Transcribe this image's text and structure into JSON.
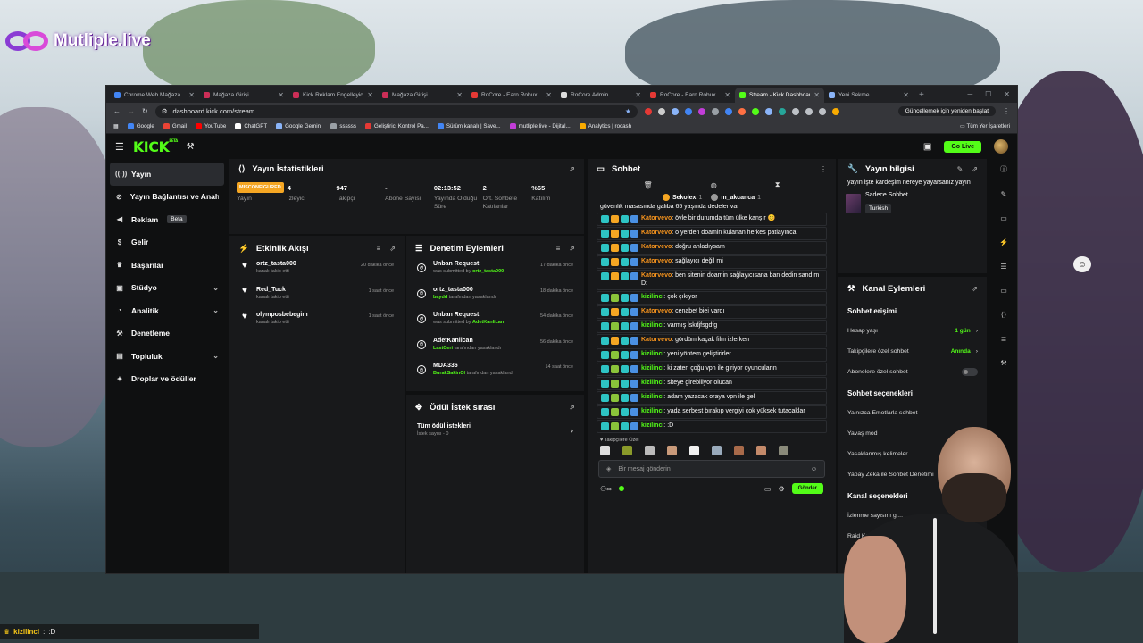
{
  "overlay": {
    "logo_text": "Mutliple.live"
  },
  "bottom_chat": {
    "user": "kizilinci",
    "text": ":D"
  },
  "browser": {
    "tabs": [
      {
        "label": "Chrome Web Mağaza",
        "color": "#4285f4"
      },
      {
        "label": "Mağaza Girişi",
        "color": "#cc2e57"
      },
      {
        "label": "Kick Reklam Engelleyici",
        "color": "#cc2e57"
      },
      {
        "label": "Mağaza Girişi",
        "color": "#cc2e57"
      },
      {
        "label": "RoCore - Earn Robux",
        "color": "#e53935"
      },
      {
        "label": "RoCore Admin",
        "color": "#dddddd"
      },
      {
        "label": "RoCore - Earn Robux",
        "color": "#e53935"
      },
      {
        "label": "Stream - Kick Dashboard",
        "color": "#53fc18"
      },
      {
        "label": "Yeni Sekme",
        "color": "#8ab4f8"
      }
    ],
    "url": "dashboard.kick.com/stream",
    "update_btn": "Güncellemek için yeniden başlat",
    "bookmarks": [
      {
        "label": "Google",
        "color": "#4285f4"
      },
      {
        "label": "Gmail",
        "color": "#ea4335"
      },
      {
        "label": "YouTube",
        "color": "#ff0000"
      },
      {
        "label": "ChatGPT",
        "color": "#ffffff"
      },
      {
        "label": "Google Gemini",
        "color": "#8ab4f8"
      },
      {
        "label": "ssssss",
        "color": "#9aa0a6"
      },
      {
        "label": "Geliştirici Kontrol Pa...",
        "color": "#e53935"
      },
      {
        "label": "Sürüm kanalı | Save...",
        "color": "#4285f4"
      },
      {
        "label": "mutliple.live - Dijital...",
        "color": "#c23dd8"
      },
      {
        "label": "Analytics | rocash",
        "color": "#f9ab00"
      }
    ],
    "all_bookmarks": "Tüm Yer İşaretleri"
  },
  "kick": {
    "logo": "KICK",
    "logo_sup": "BETA",
    "go_live": "Go Live"
  },
  "sidebar": {
    "items": [
      {
        "label": "Yayın",
        "icon": "broadcast-icon"
      },
      {
        "label": "Yayın Bağlantısı ve Anahtarı",
        "icon": "link-icon"
      },
      {
        "label": "Reklam",
        "icon": "megaphone-icon",
        "badge": "Beta"
      },
      {
        "label": "Gelir",
        "icon": "dollar-icon"
      },
      {
        "label": "Başarılar",
        "icon": "trophy-icon"
      },
      {
        "label": "Stüdyo",
        "icon": "studio-icon",
        "chevron": true
      },
      {
        "label": "Analitik",
        "icon": "analytics-icon",
        "chevron": true
      },
      {
        "label": "Denetleme",
        "icon": "hammer-icon"
      },
      {
        "label": "Topluluk",
        "icon": "community-icon",
        "chevron": true
      },
      {
        "label": "Droplar ve ödüller",
        "icon": "gift-icon"
      }
    ]
  },
  "stats": {
    "title": "Yayın İstatistikleri",
    "misconfigured": "MISCONFIGURED",
    "items": [
      {
        "label": "Yayın",
        "value": ""
      },
      {
        "label": "İzleyici",
        "value": "4"
      },
      {
        "label": "Takipçi",
        "value": "947"
      },
      {
        "label": "Abone Sayısı",
        "value": "-"
      },
      {
        "label": "Yayında Olduğu Süre",
        "value": "02:13:52"
      },
      {
        "label": "Ort. Sohbete Katılanlar",
        "value": "2"
      },
      {
        "label": "Katılım",
        "value": "%65"
      }
    ]
  },
  "activity": {
    "title": "Etkinlik Akışı",
    "items": [
      {
        "user": "ortz_tasta000",
        "desc": "kanalı takip etti",
        "time": "20 dakika önce"
      },
      {
        "user": "Red_Tuck",
        "desc": "kanalı takip etti",
        "time": "1 saat önce"
      },
      {
        "user": "olymposbebegim",
        "desc": "kanalı takip etti",
        "time": "1 saat önce"
      }
    ]
  },
  "moderation": {
    "title": "Denetim Eylemleri",
    "items": [
      {
        "title": "Unban Request",
        "pre": "was submitted by ",
        "by": "ortz_tasta000",
        "post": "",
        "time": "17 dakika önce"
      },
      {
        "title": "ortz_tasta000",
        "pre": "",
        "by": "baydd",
        "post": " tarafından yasaklandı",
        "time": "18 dakika önce"
      },
      {
        "title": "Unban Request",
        "pre": "was submitted by ",
        "by": "AdetKanlican",
        "post": "",
        "time": "54 dakika önce"
      },
      {
        "title": "AdetKanlican",
        "pre": "",
        "by": "LastCeri",
        "post": " tarafından yasaklandı",
        "time": "56 dakika önce"
      },
      {
        "title": "MDA336",
        "pre": "",
        "by": "BurakSakinOl",
        "post": " tarafından yasaklandı",
        "time": "14 saat önce"
      }
    ]
  },
  "rewards": {
    "title": "Ödül İstek sırası",
    "item_title": "Tüm ödül istekleri",
    "item_sub": "İstek sayısı - 0"
  },
  "chat": {
    "title": "Sohbet",
    "pins": [
      {
        "name": "Sekolex",
        "count": "1",
        "color": "#f5a623"
      },
      {
        "name": "m_akcanca",
        "count": "1",
        "color": "#9a9a9a"
      }
    ],
    "top_partial": "güvenlik masasında galiba 65 yaşında dedeler var",
    "messages": [
      {
        "user": "Katorvevo",
        "kind": "k",
        "text": "öyle bir durumda tüm ülke kanşır 😊"
      },
      {
        "user": "Katorvevo",
        "kind": "k",
        "text": "o yerden doamin kulanan herkes patlayınca"
      },
      {
        "user": "Katorvevo",
        "kind": "k",
        "text": "doğru anladıysam"
      },
      {
        "user": "Katorvevo",
        "kind": "k",
        "text": "sağlayıcı değil mi"
      },
      {
        "user": "Katorvevo",
        "kind": "k",
        "text": "ben sitenin doamin sağlayıcısana ban dedin sandım D:"
      },
      {
        "user": "kizilinci",
        "kind": "z",
        "text": "çok çıkıyor"
      },
      {
        "user": "Katorvevo",
        "kind": "k",
        "text": "cenabet biei vardı"
      },
      {
        "user": "kizilinci",
        "kind": "z",
        "text": "varmış lskdjfsgdfg"
      },
      {
        "user": "Katorvevo",
        "kind": "k",
        "text": "gördüm kaçak film izlerken"
      },
      {
        "user": "kizilinci",
        "kind": "z",
        "text": "yeni yöntem geliştirirler"
      },
      {
        "user": "kizilinci",
        "kind": "z",
        "text": "ki zaten çoğu vpn ile giriyor oyuncuların"
      },
      {
        "user": "kizilinci",
        "kind": "z",
        "text": "siteye girebiliyor olucan"
      },
      {
        "user": "kizilinci",
        "kind": "z",
        "text": "adam yazacak oraya vpn ile gel"
      },
      {
        "user": "kizilinci",
        "kind": "z",
        "text": "yada serbest bırakıp vergiyi çok yüksek tutacaklar"
      },
      {
        "user": "kizilinci",
        "kind": "z",
        "text": ":D"
      }
    ],
    "follow_only": "Takipçilere Özel",
    "placeholder": "Bir mesaj gönderin",
    "send": "Gönder"
  },
  "stream_info": {
    "title": "Yayın bilgisi",
    "stream_title": "yayın işte kardeşim nereye yayarsanız yayın",
    "category": "Sadece Sohbet",
    "tag": "Turkish"
  },
  "channel_actions": {
    "title": "Kanal Eylemleri",
    "chat_access": "Sohbet erişimi",
    "account_age": {
      "label": "Hesap yaşı",
      "value": "1 gün"
    },
    "followers_only": {
      "label": "Takipçilere özel sohbet",
      "value": "Anında"
    },
    "subs_only": "Abonelere özel sohbet",
    "chat_options": "Sohbet seçenekleri",
    "emote_only": "Yalnızca Emotlarla sohbet",
    "slow_mode": "Yavaş mod",
    "banned_words": "Yasaklanmış kelimeler",
    "ai_moderation": "Yapay Zeka ile Sohbet Denetimi",
    "channel_options": "Kanal seçenekleri",
    "viewer_count": "İzlenme sayısını gi...",
    "raid": "Raid Kanalı..."
  }
}
